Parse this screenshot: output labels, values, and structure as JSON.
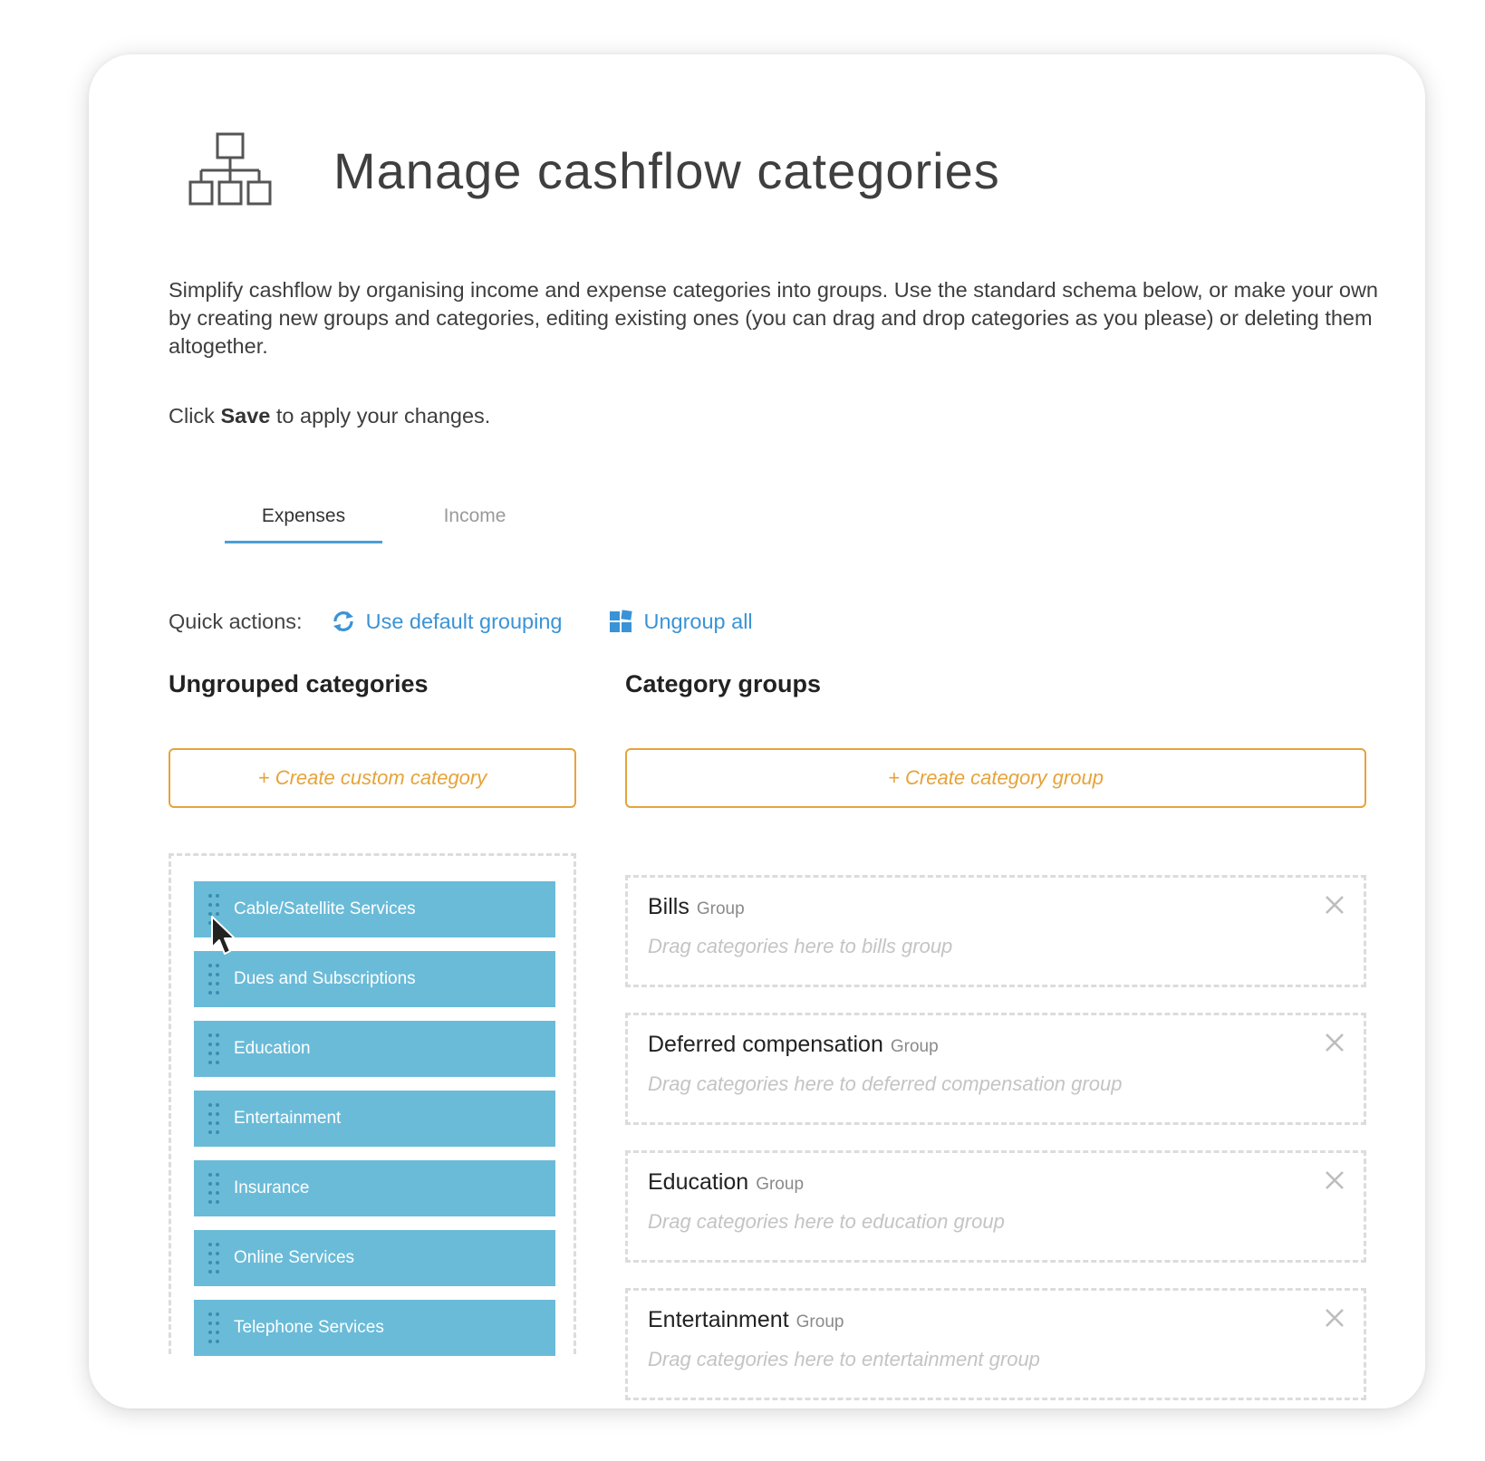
{
  "header": {
    "title": "Manage cashflow categories",
    "icon": "hierarchy-icon"
  },
  "intro": {
    "text": "Simplify cashflow by organising income and expense categories into groups. Use the standard schema below, or make your own by creating new groups and categories, editing existing ones (you can drag and drop categories as you please) or deleting them altogether.",
    "save_prefix": "Click ",
    "save_word": "Save",
    "save_suffix": " to apply your changes."
  },
  "tabs": [
    {
      "label": "Expenses",
      "active": true
    },
    {
      "label": "Income",
      "active": false
    }
  ],
  "quick_actions": {
    "label": "Quick actions:",
    "default_grouping": {
      "label": "Use default grouping",
      "icon": "refresh-icon"
    },
    "ungroup_all": {
      "label": "Ungroup all",
      "icon": "grid-icon"
    }
  },
  "ungrouped": {
    "title": "Ungrouped categories",
    "create_label": "+ Create custom category",
    "items": [
      {
        "label": "Cable/Satellite Services"
      },
      {
        "label": "Dues and Subscriptions"
      },
      {
        "label": "Education"
      },
      {
        "label": "Entertainment"
      },
      {
        "label": "Insurance"
      },
      {
        "label": "Online Services"
      },
      {
        "label": "Telephone Services"
      }
    ]
  },
  "category_groups": {
    "title": "Category groups",
    "create_label": "+ Create category group",
    "groups": [
      {
        "name": "Bills",
        "tag": "Group",
        "drop_hint": "Drag categories here to bills group"
      },
      {
        "name": "Deferred compensation",
        "tag": "Group",
        "drop_hint": "Drag categories here to deferred compensation group"
      },
      {
        "name": "Education",
        "tag": "Group",
        "drop_hint": "Drag categories here to education group"
      },
      {
        "name": "Entertainment",
        "tag": "Group",
        "drop_hint": "Drag categories here to entertainment group"
      }
    ]
  },
  "colors": {
    "accent_blue": "#3a93d6",
    "tab_underline": "#4a9fd8",
    "category_fill": "#6abbd8",
    "create_orange": "#e6a33a",
    "dashed_border": "#dcdcdc"
  }
}
